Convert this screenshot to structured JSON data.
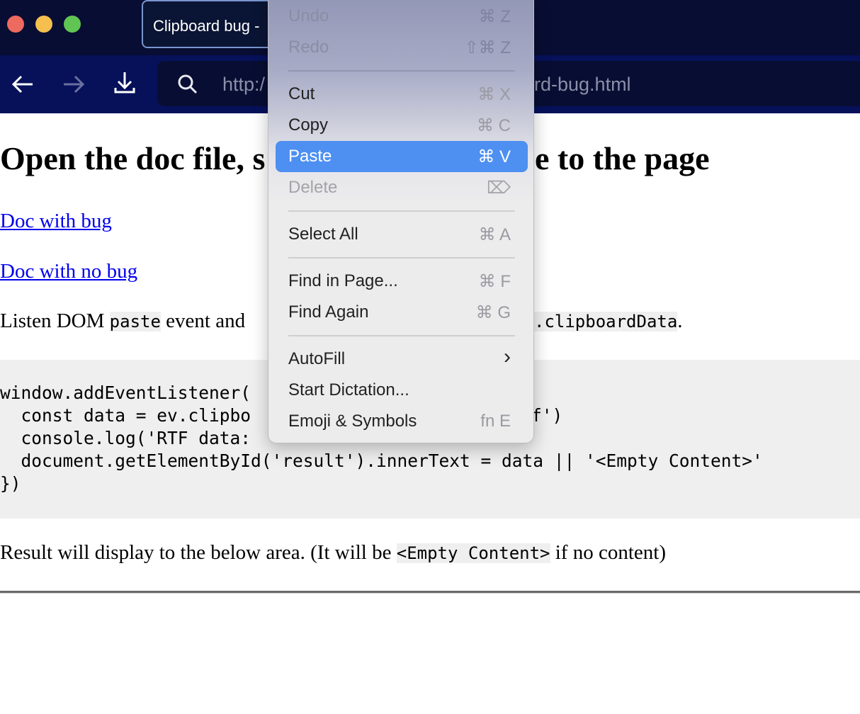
{
  "window": {
    "tab_title": "Clipboard bug -",
    "traffic_lights": {
      "close": "#ed6a5e",
      "minimize": "#f5bf4f",
      "zoom": "#61c554"
    }
  },
  "toolbar": {
    "back_icon": "arrow-left-icon",
    "forward_icon": "arrow-right-icon",
    "download_icon": "download-icon",
    "search_icon": "search-icon",
    "url_start": "http:/",
    "url_end": "rd-bug.html"
  },
  "page": {
    "heading_left": "Open the doc file, s",
    "heading_right": "e to the page",
    "link_bug": "Doc with bug",
    "link_no_bug": "Doc with no bug",
    "para_left": "Listen DOM ",
    "para_code1": "paste",
    "para_mid": " event and",
    "para_code2": ".clipboardData",
    "para_end": ".",
    "code_lines": [
      "window.addEventListener(",
      "  const data = ev.clipbo",
      "f')",
      "  console.log('RTF data:",
      "  document.getElementById('result').innerText = data || '<Empty Content>'",
      "})"
    ],
    "result_text_before": "Result will display to the below area. (It will be ",
    "result_code": "<Empty Content>",
    "result_text_after": " if no content)"
  },
  "context_menu": {
    "highlight_color": "#4e8ff2",
    "items": [
      {
        "label": "Undo",
        "shortcut": "⌘ Z",
        "disabled": true
      },
      {
        "label": "Redo",
        "shortcut": "⇧⌘ Z",
        "disabled": true
      },
      {
        "label": "Cut",
        "shortcut": "⌘ X"
      },
      {
        "label": "Copy",
        "shortcut": "⌘ C"
      },
      {
        "label": "Paste",
        "shortcut": "⌘ V",
        "highlighted": true
      },
      {
        "label": "Delete",
        "shortcut": "⌦",
        "disabled": true
      },
      {
        "label": "Select All",
        "shortcut": "⌘ A"
      },
      {
        "label": "Find in Page...",
        "shortcut": "⌘ F"
      },
      {
        "label": "Find Again",
        "shortcut": "⌘ G"
      },
      {
        "label": "AutoFill",
        "shortcut": "›"
      },
      {
        "label": "Start Dictation...",
        "shortcut": ""
      },
      {
        "label": "Emoji & Symbols",
        "shortcut": "fn E"
      }
    ]
  }
}
